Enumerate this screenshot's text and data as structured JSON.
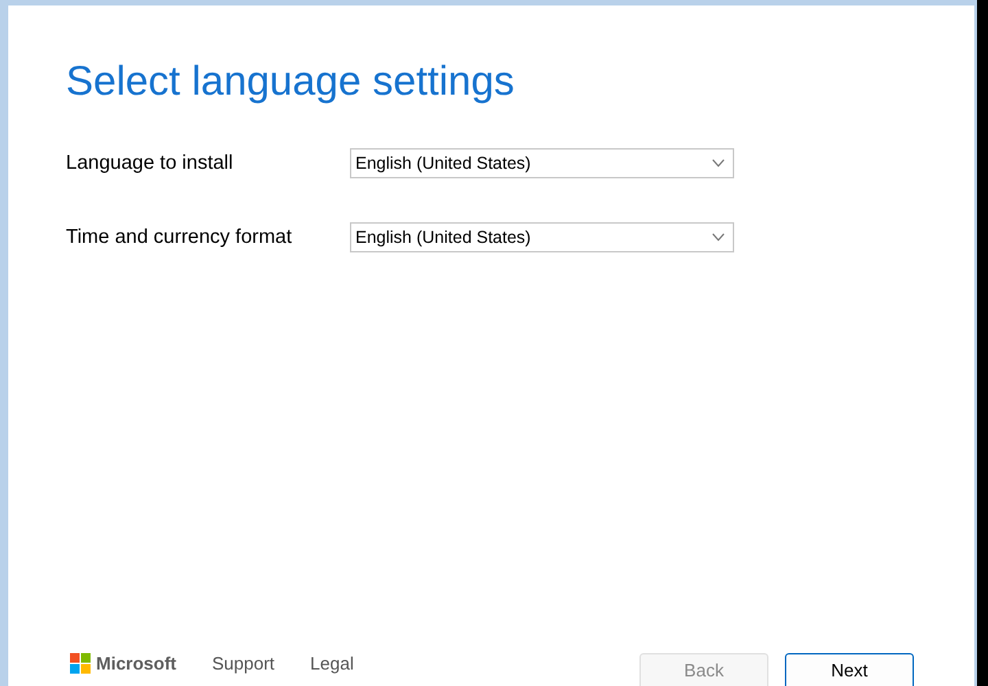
{
  "title": "Select language settings",
  "fields": [
    {
      "label": "Language to install",
      "value": "English (United States)"
    },
    {
      "label": "Time and currency format",
      "value": "English (United States)"
    }
  ],
  "footer": {
    "brand": "Microsoft",
    "links": [
      "Support",
      "Legal"
    ]
  },
  "buttons": [
    {
      "label": "Back",
      "disabled": true,
      "default": false
    },
    {
      "label": "Next",
      "disabled": false,
      "default": true
    }
  ]
}
